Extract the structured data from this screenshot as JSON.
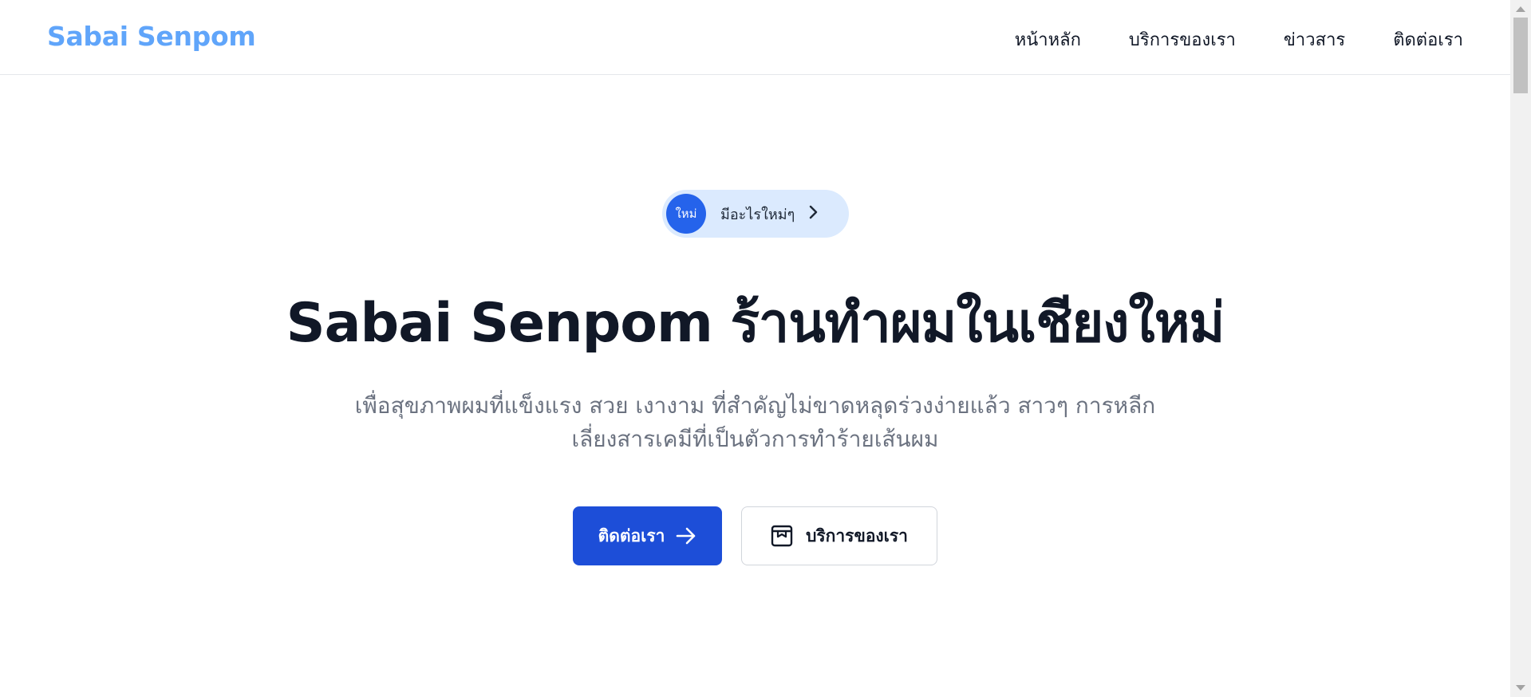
{
  "header": {
    "brand": "Sabai Senpom",
    "nav": [
      {
        "label": "หน้าหลัก"
      },
      {
        "label": "บริการของเรา"
      },
      {
        "label": "ข่าวสาร"
      },
      {
        "label": "ติดต่อเรา"
      }
    ]
  },
  "hero": {
    "badge": {
      "pill": "ใหม่",
      "text": "มีอะไรใหม่ๆ",
      "icon": "chevron-right-icon"
    },
    "headline": "Sabai Senpom ร้านทำผมในเชียงใหม่",
    "subtext": "เพื่อสุขภาพผมที่แข็งแรง สวย เงางาม ที่สำคัญไม่ขาดหลุดร่วงง่ายแล้ว สาวๆ การหลีกเลี่ยงสารเคมีที่เป็นตัวการทำร้ายเส้นผม",
    "primary_button": {
      "label": "ติดต่อเรา",
      "icon": "arrow-right-icon"
    },
    "secondary_button": {
      "label": "บริการของเรา",
      "icon": "box-icon"
    }
  },
  "colors": {
    "brand": "#60a5fa",
    "primary": "#1d4ed8",
    "badge_bg": "#dbeafe",
    "badge_pill": "#2563eb",
    "headline": "#111827",
    "muted": "#6b7280"
  }
}
